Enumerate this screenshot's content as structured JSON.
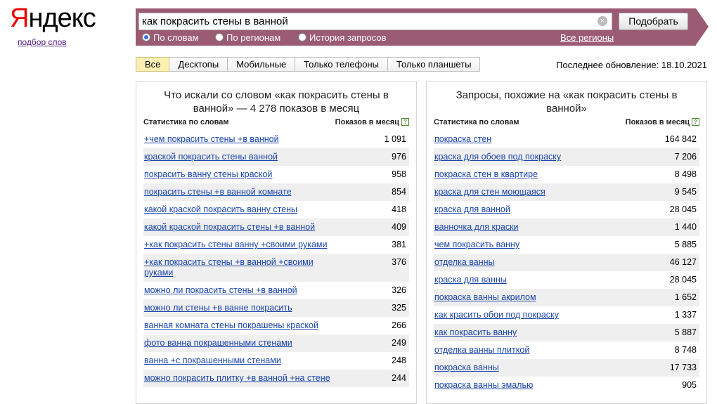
{
  "brand": {
    "logo_first": "Я",
    "logo_rest": "ндекс",
    "sublink": "подбор слов"
  },
  "search": {
    "value": "как покрасить стены в ванной",
    "clear_glyph": "×",
    "button": "Подобрать"
  },
  "radios": [
    {
      "label": "По словам",
      "selected": true
    },
    {
      "label": "По регионам",
      "selected": false
    },
    {
      "label": "История запросов",
      "selected": false
    }
  ],
  "all_regions": "Все регионы",
  "tabs": [
    {
      "label": "Все",
      "active": true
    },
    {
      "label": "Десктопы",
      "active": false
    },
    {
      "label": "Мобильные",
      "active": false
    },
    {
      "label": "Только телефоны",
      "active": false
    },
    {
      "label": "Только планшеты",
      "active": false
    }
  ],
  "updated": "Последнее обновление: 18.10.2021",
  "left": {
    "title": "Что искали со словом «как покрасить стены в ванной» — 4 278 показов в месяц",
    "col_stat": "Статистика по словам",
    "col_shows": "Показов в месяц",
    "rows": [
      {
        "q": "+чем покрасить стены +в ванной",
        "n": "1 091"
      },
      {
        "q": "краской покрасить стены ванной",
        "n": "976"
      },
      {
        "q": "покрасить ванну стены краской",
        "n": "958"
      },
      {
        "q": "покрасить стены +в ванной комнате",
        "n": "854"
      },
      {
        "q": "какой краской покрасить ванну стены",
        "n": "418"
      },
      {
        "q": "какой краской покрасить стены +в ванной",
        "n": "409"
      },
      {
        "q": "+как покрасить стены ванну +своими руками",
        "n": "381"
      },
      {
        "q": "+как покрасить стены +в ванной +своими руками",
        "n": "376"
      },
      {
        "q": "можно ли покрасить стены +в ванной",
        "n": "326"
      },
      {
        "q": "можно ли стены +в ванне покрасить",
        "n": "325"
      },
      {
        "q": "ванная комната стены покрашены краской",
        "n": "266"
      },
      {
        "q": "фото ванна покрашенными стенами",
        "n": "249"
      },
      {
        "q": "ванна +с покрашенными стенами",
        "n": "248"
      },
      {
        "q": "можно покрасить плитку +в ванной +на стене",
        "n": "244"
      }
    ]
  },
  "right": {
    "title": "Запросы, похожие на «как покрасить стены в ванной»",
    "col_stat": "Статистика по словам",
    "col_shows": "Показов в месяц",
    "rows": [
      {
        "q": "покраска стен",
        "n": "164 842"
      },
      {
        "q": "краска для обоев под покраску",
        "n": "7 206"
      },
      {
        "q": "покраска стен в квартире",
        "n": "8 498"
      },
      {
        "q": "краска для стен моющаяся",
        "n": "9 545"
      },
      {
        "q": "краска для ванной",
        "n": "28 045"
      },
      {
        "q": "ванночка для краски",
        "n": "1 440"
      },
      {
        "q": "чем покрасить ванну",
        "n": "5 885"
      },
      {
        "q": "отделка ванны",
        "n": "46 127"
      },
      {
        "q": "краска для ванны",
        "n": "28 045"
      },
      {
        "q": "покраска ванны акрилом",
        "n": "1 652"
      },
      {
        "q": "как красить обои под покраску",
        "n": "1 337"
      },
      {
        "q": "как покрасить ванну",
        "n": "5 887"
      },
      {
        "q": "отделка ванны плиткой",
        "n": "8 748"
      },
      {
        "q": "покраска ванны",
        "n": "17 733"
      },
      {
        "q": "покраска ванны эмалью",
        "n": "905"
      }
    ]
  }
}
